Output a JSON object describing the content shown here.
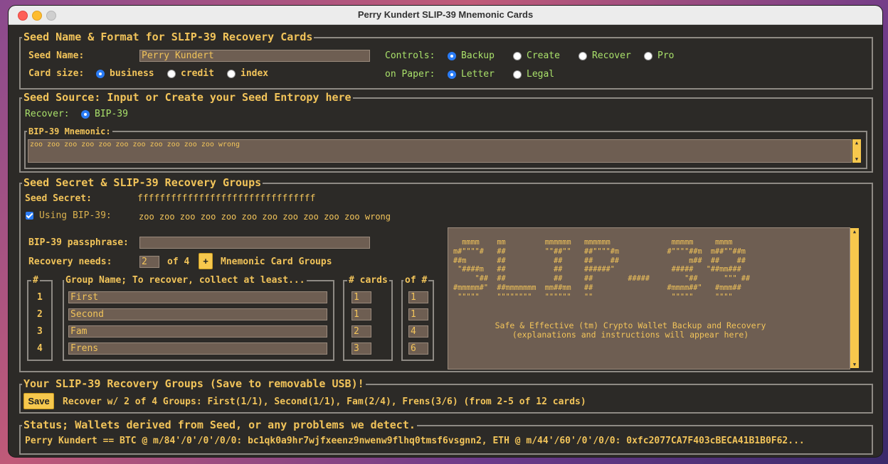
{
  "window": {
    "title": "Perry Kundert SLIP-39 Mnemonic Cards"
  },
  "seed_format": {
    "legend": "Seed Name & Format for SLIP-39 Recovery Cards",
    "seed_name_label": "Seed Name:",
    "seed_name_value": "Perry Kundert",
    "card_size_label": "Card size:",
    "card_sizes": [
      "business",
      "credit",
      "index"
    ],
    "card_size_selected": "business",
    "controls_label": "Controls:",
    "controls": [
      "Backup",
      "Create",
      "Recover",
      "Pro"
    ],
    "controls_selected": "Backup",
    "paper_label": "on Paper:",
    "papers": [
      "Letter",
      "Legal"
    ],
    "paper_selected": "Letter"
  },
  "seed_source": {
    "legend": "Seed Source: Input or Create your Seed Entropy here",
    "recover_label": "Recover:",
    "recover_option": "BIP-39",
    "mnemonic_legend": "BIP-39 Mnemonic:",
    "mnemonic_value": "zoo zoo zoo zoo zoo zoo zoo zoo zoo zoo zoo wrong"
  },
  "seed_secret": {
    "legend": "Seed Secret & SLIP-39 Recovery Groups",
    "secret_label": "Seed Secret:",
    "secret_value": "ffffffffffffffffffffffffffffffff",
    "using_bip39_label": "Using BIP-39:",
    "using_bip39_checked": true,
    "using_bip39_value": "zoo zoo zoo zoo zoo zoo zoo zoo zoo zoo zoo wrong",
    "passphrase_label": "BIP-39 passphrase:",
    "passphrase_value": "",
    "recovery_needs_label": "Recovery needs:",
    "recovery_needs_value": "2",
    "of_label": "of 4",
    "plus_label": "+",
    "groups_label": "Mnemonic Card Groups",
    "headers": {
      "num": "#",
      "name": "Group Name; To recover, collect at least...",
      "cards": "# cards",
      "of": "of #"
    },
    "groups": [
      {
        "num": "1",
        "name": "First",
        "cards": "1",
        "of": "1"
      },
      {
        "num": "2",
        "name": "Second",
        "cards": "1",
        "of": "1"
      },
      {
        "num": "3",
        "name": "Fam",
        "cards": "2",
        "of": "4"
      },
      {
        "num": "4",
        "name": "Frens",
        "cards": "3",
        "of": "6"
      }
    ],
    "info_art": "  mmmm    mm         mmmmmm   mmmmmm              mmmmm     mmmm\nm#\"\"\"\"#   ##         \"\"##\"\"   ##\"\"\"\"#m           #\"\"\"\"##m  m##\"\"##m\n##m       ##           ##     ##    ##                m##  ##    ##\n \"####m   ##           ##     ######\"             #####   \"##mm###\n     \"##  ##           ##     ##        #####        \"##      \"\"\" ##\n#mmmmm#\"  ##mmmmmmm  mm##mm   ##                 #mmmm##\"   #mmm##\n \"\"\"\"\"    \"\"\"\"\"\"\"\"   \"\"\"\"\"\"   \"\"                  \"\"\"\"\"     \"\"\"\"",
    "info_line1": "Safe & Effective (tm) Crypto Wallet Backup and Recovery",
    "info_line2": "(explanations and instructions will appear here)"
  },
  "recovery_groups": {
    "legend": "Your SLIP-39 Recovery Groups (Save to removable USB)!",
    "save_label": "Save",
    "summary": "Recover w/ 2 of 4 Groups: First(1/1), Second(1/1), Fam(2/4), Frens(3/6) (from 2-5 of 12 cards)"
  },
  "status": {
    "legend": "Status; Wallets derived from Seed, or any problems we detect.",
    "text": "Perry Kundert == BTC @ m/84'/0'/0'/0/0: bc1qk0a9hr7wjfxeenz9nwenw9flhq0tmsf6vsgnn2, ETH @ m/44'/60'/0'/0/0: 0xfc2077CA7F403cBECA41B1B0F62..."
  },
  "colors": {
    "accent": "#f2c45a",
    "green": "#a9e06a",
    "field": "#6e5e52",
    "bg": "#2c2a27"
  }
}
